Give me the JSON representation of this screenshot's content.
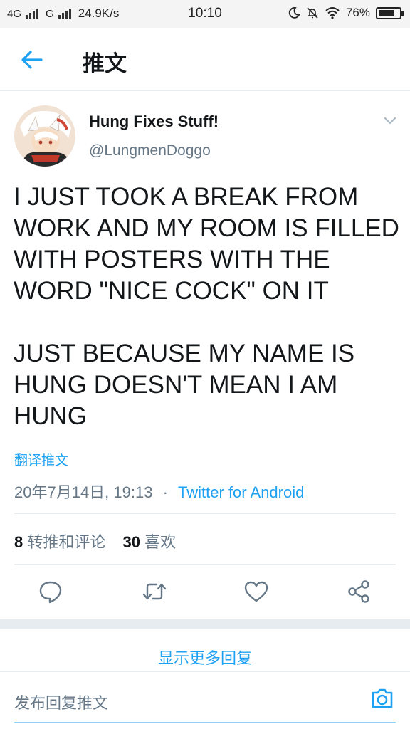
{
  "status_bar": {
    "network1": "4G",
    "network2": "G",
    "speed": "24.9K/s",
    "time": "10:10",
    "battery": "76%",
    "battery_level": 0.76
  },
  "header": {
    "title": "推文",
    "back_icon": "arrow-left-icon"
  },
  "tweet": {
    "author_name": "Hung Fixes Stuff!",
    "author_handle": "@LungmenDoggo",
    "text": "I JUST TOOK A BREAK FROM WORK AND MY ROOM IS FILLED WITH POSTERS WITH THE WORD \"NICE COCK\" ON IT\n\nJUST BECAUSE MY NAME IS HUNG DOESN'T MEAN I AM HUNG",
    "translate_label": "翻译推文",
    "date": "20年7月14日, 19:13",
    "separator": "·",
    "source": "Twitter for Android",
    "retweets_count": "8",
    "retweets_label": "转推和评论",
    "likes_count": "30",
    "likes_label": "喜欢"
  },
  "actions": {
    "reply_icon": "reply-bubble-icon",
    "retweet_icon": "retweet-icon",
    "like_icon": "heart-icon",
    "share_icon": "share-icon"
  },
  "replies": {
    "show_more": "显示更多回复",
    "compose_placeholder": "发布回复推文",
    "camera_icon": "camera-icon"
  },
  "colors": {
    "accent": "#1da1f2",
    "secondary_text": "#657786",
    "divider": "#e6ecf0"
  }
}
